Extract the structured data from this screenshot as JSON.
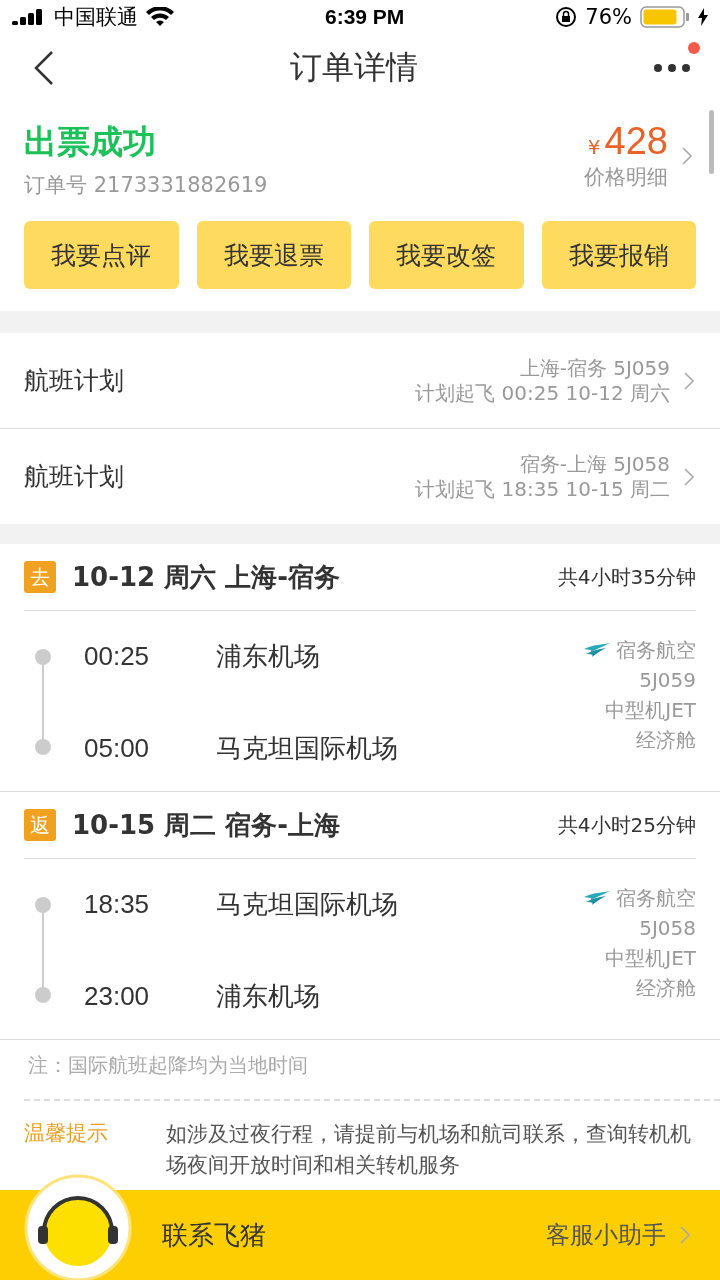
{
  "status_bar": {
    "carrier": "中国联通",
    "time": "6:39 PM",
    "battery": "76%"
  },
  "header": {
    "title": "订单详情",
    "more_badge": true
  },
  "order": {
    "status": "出票成功",
    "order_no": "订单号 2173331882619",
    "currency": "¥",
    "price": "428",
    "price_link": "价格明细"
  },
  "actions": [
    "我要点评",
    "我要退票",
    "我要改签",
    "我要报销"
  ],
  "flight_plans": [
    {
      "label": "航班计划",
      "route": "上海-宿务 5J059",
      "departure": "计划起飞 00:25 10-12 周六"
    },
    {
      "label": "航班计划",
      "route": "宿务-上海 5J058",
      "departure": "计划起飞 18:35 10-15 周二"
    }
  ],
  "segments": [
    {
      "tag": "去",
      "title": "10-12 周六 上海-宿务",
      "duration": "共4小时35分钟",
      "stops": [
        {
          "time": "00:25",
          "airport": "浦东机场"
        },
        {
          "time": "05:00",
          "airport": "马克坦国际机场"
        }
      ],
      "airline": "宿务航空",
      "flight": "5J059",
      "aircraft": "中型机JET",
      "cabin": "经济舱"
    },
    {
      "tag": "返",
      "title": "10-15 周二 宿务-上海",
      "duration": "共4小时25分钟",
      "stops": [
        {
          "time": "18:35",
          "airport": "马克坦国际机场"
        },
        {
          "time": "23:00",
          "airport": "浦东机场"
        }
      ],
      "airline": "宿务航空",
      "flight": "5J058",
      "aircraft": "中型机JET",
      "cabin": "经济舱"
    }
  ],
  "note": "注：国际航班起降均为当地时间",
  "tip": {
    "label": "温馨提示",
    "text": "如涉及过夜行程，请提前与机场和航司联系，查询转机机场夜间开放时间和相关转机服务"
  },
  "bottom_bar": {
    "contact": "联系飞猪",
    "assistant": "客服小助手"
  }
}
